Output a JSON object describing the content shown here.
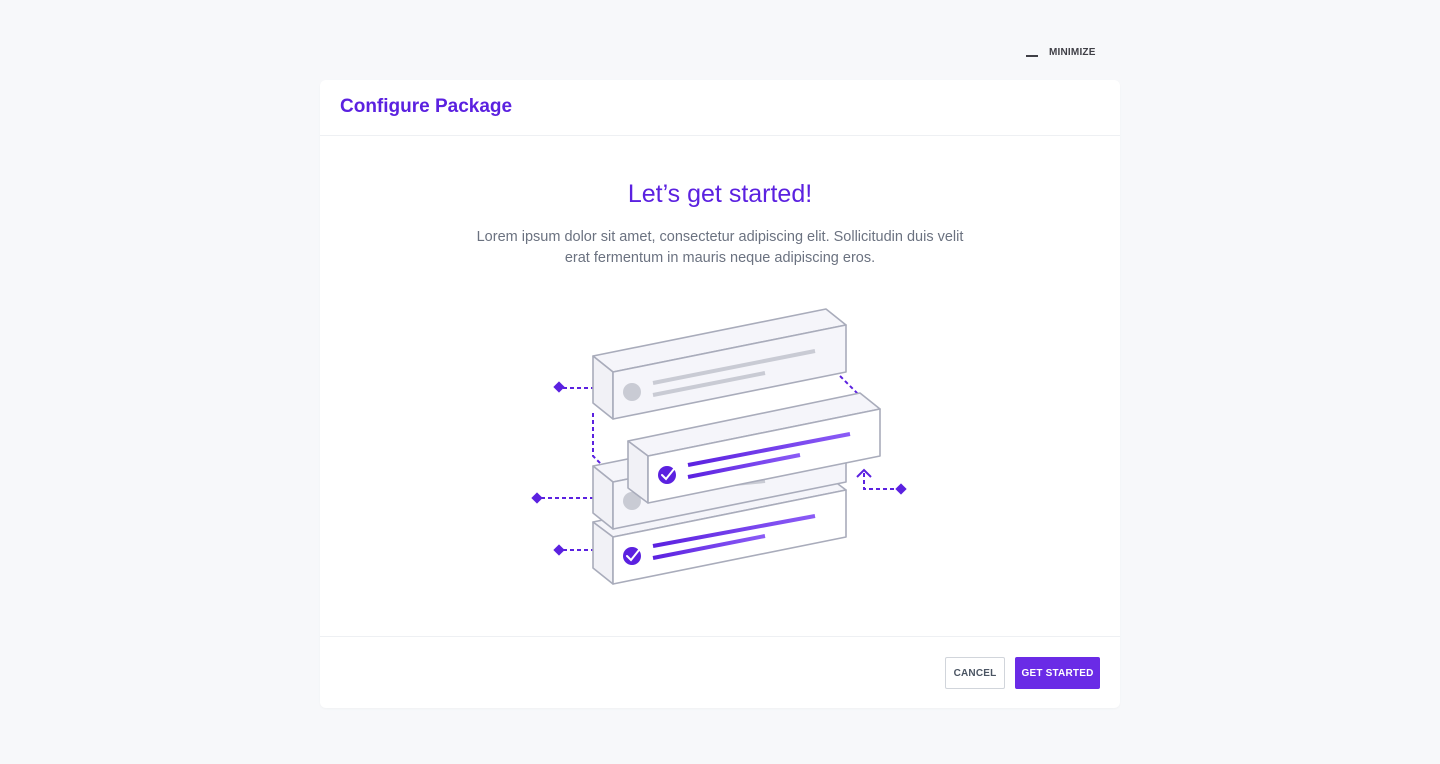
{
  "window": {
    "minimize_label": "MINIMIZE"
  },
  "dialog": {
    "title": "Configure Package",
    "headline": "Let’s get started!",
    "description": "Lorem ipsum dolor sit amet, consectetur adipiscing elit. Sollicitudin duis velit erat fermentum in mauris neque adipiscing eros.",
    "illustration": "stacked-package-blocks-illustration"
  },
  "footer": {
    "cancel_label": "CANCEL",
    "primary_label": "GET STARTED"
  },
  "colors": {
    "accent": "#5b21e0",
    "primary_button": "#6a2be6",
    "text_muted": "#6b7280",
    "background": "#f7f8fa"
  }
}
